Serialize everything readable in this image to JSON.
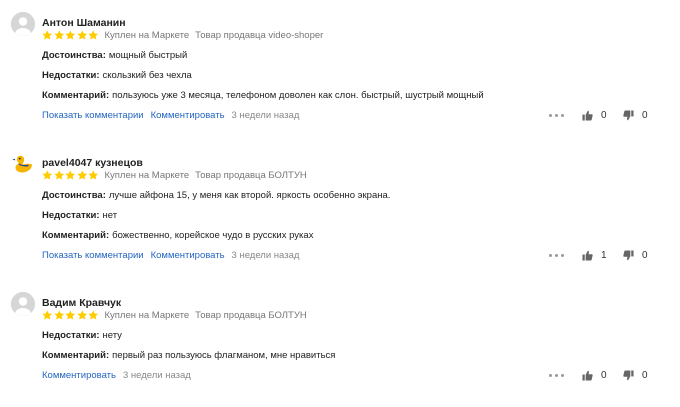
{
  "colors": {
    "star": "#ffcc00",
    "link": "#2566c2",
    "muted": "#777777"
  },
  "reviews": [
    {
      "author": "Антон Шаманин",
      "avatar": "default-avatar-icon",
      "rating": 5,
      "verified": "Куплен на Маркете",
      "seller": "Товар продавца video-shoper",
      "fields": [
        {
          "label": "Достоинства:",
          "text": "мощный быстрый"
        },
        {
          "label": "Недостатки:",
          "text": "скользкий без чехла"
        },
        {
          "label": "Комментарий:",
          "text": "пользуюсь уже 3 месяца, телефоном доволен как слон. быстрый, шустрый мощный"
        }
      ],
      "show_comments": "Показать комментарии",
      "comment": "Комментировать",
      "date": "3 недели назад",
      "likes": "0",
      "dislikes": "0"
    },
    {
      "author": "pavel4047 кузнецов",
      "avatar": "duck-avatar-icon",
      "rating": 5,
      "verified": "Куплен на Маркете",
      "seller": "Товар продавца БОЛТУН",
      "fields": [
        {
          "label": "Достоинства:",
          "text": "лучше айфона 15, у меня как второй. яркость особенно экрана."
        },
        {
          "label": "Недостатки:",
          "text": "нет"
        },
        {
          "label": "Комментарий:",
          "text": "божественно, корейское чудо в русских руках"
        }
      ],
      "show_comments": "Показать комментарии",
      "comment": "Комментировать",
      "date": "3 недели назад",
      "likes": "1",
      "dislikes": "0"
    },
    {
      "author": "Вадим Кравчук",
      "avatar": "default-avatar-icon",
      "rating": 5,
      "verified": "Куплен на Маркете",
      "seller": "Товар продавца БОЛТУН",
      "fields": [
        {
          "label": "Недостатки:",
          "text": "нету"
        },
        {
          "label": "Комментарий:",
          "text": "первый раз пользуюсь флагманом, мне нравиться"
        }
      ],
      "comment": "Комментировать",
      "date": "3 недели назад",
      "likes": "0",
      "dislikes": "0"
    }
  ]
}
